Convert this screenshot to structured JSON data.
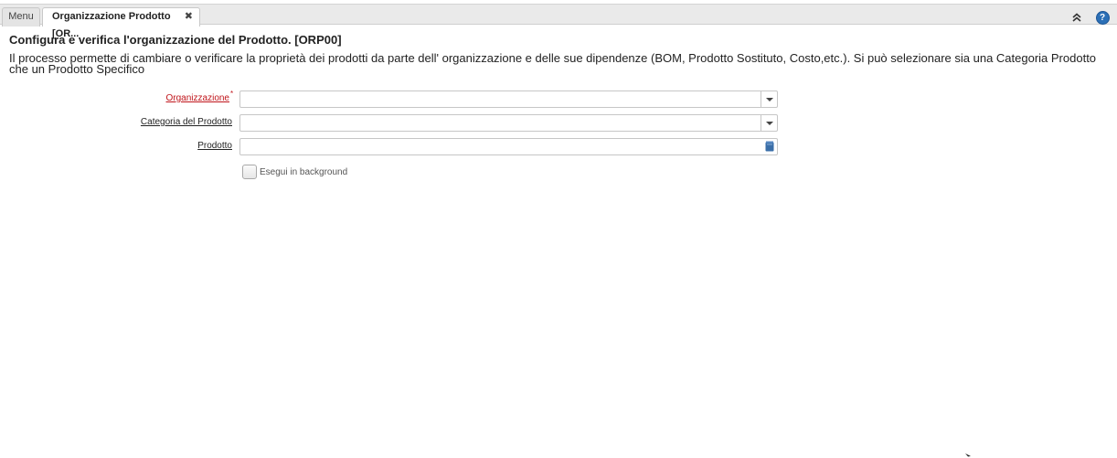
{
  "tabs": {
    "menu_label": "Menu",
    "active_label": "Organizzazione Prodotto [OR...",
    "close_symbol": "✖"
  },
  "toolbar": {
    "collapse_icon": "double-chevron-up-icon",
    "help_icon": "help-icon",
    "help_symbol": "?"
  },
  "process": {
    "title": "Configura e verifica l'organizzazione del Prodotto. [ORP00]",
    "description": "Il processo permette di cambiare o verificare la proprietà dei prodotti da parte dell' organizzazione e delle sue dipendenze (BOM, Prodotto Sostituto, Costo,etc.). Si può selezionare sia una Categoria Prodotto che un Prodotto Specifico"
  },
  "form": {
    "organization": {
      "label": "Organizzazione",
      "required_mark": "*",
      "value": ""
    },
    "product_category": {
      "label": "Categoria del Prodotto",
      "value": ""
    },
    "product": {
      "label": "Prodotto",
      "value": ""
    },
    "background": {
      "label": "Esegui in background",
      "checked": false
    }
  },
  "colors": {
    "required": "#c0141a",
    "accent": "#2b6fb6",
    "tabbar": "#eaeaea"
  }
}
